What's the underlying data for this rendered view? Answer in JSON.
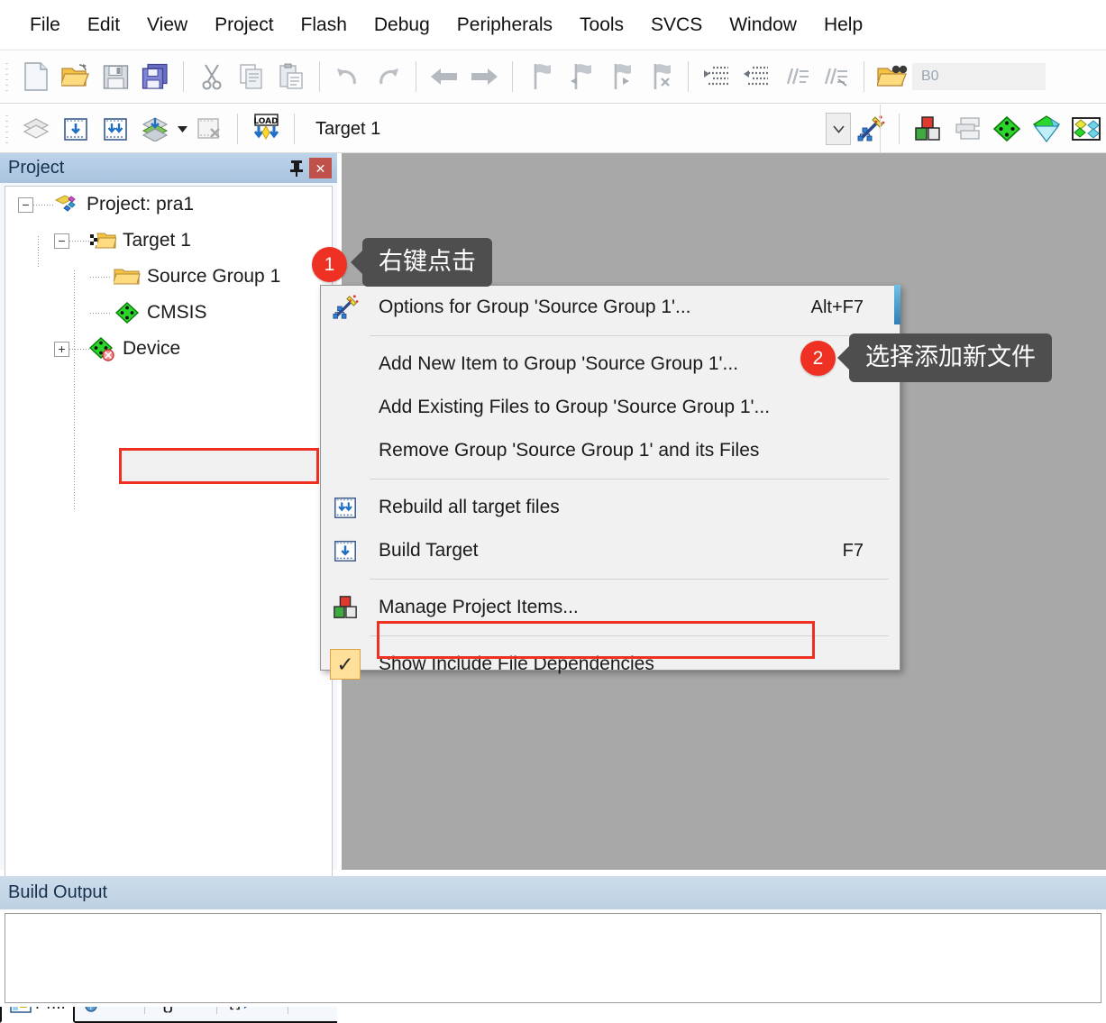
{
  "colors": {
    "accent_red": "#ef3124",
    "callout_bg": "#4e4e4e",
    "panel_header": "#bdd3ea",
    "editor_bg": "#a8a8a8",
    "menu_bg": "#f1f1f1",
    "close_btn": "#c0504a"
  },
  "menubar": {
    "items": [
      {
        "label": "File"
      },
      {
        "label": "Edit"
      },
      {
        "label": "View"
      },
      {
        "label": "Project"
      },
      {
        "label": "Flash"
      },
      {
        "label": "Debug"
      },
      {
        "label": "Peripherals"
      },
      {
        "label": "Tools"
      },
      {
        "label": "SVCS"
      },
      {
        "label": "Window"
      },
      {
        "label": "Help"
      }
    ]
  },
  "toolbar1": {
    "buttons": [
      {
        "name": "new-file-icon",
        "title": "New"
      },
      {
        "name": "open-file-icon",
        "title": "Open"
      },
      {
        "name": "save-icon",
        "title": "Save"
      },
      {
        "name": "save-all-icon",
        "title": "Save All"
      },
      {
        "name": "cut-icon",
        "title": "Cut"
      },
      {
        "name": "copy-icon",
        "title": "Copy"
      },
      {
        "name": "paste-icon",
        "title": "Paste"
      },
      {
        "name": "undo-icon",
        "title": "Undo"
      },
      {
        "name": "redo-icon",
        "title": "Redo"
      },
      {
        "name": "navigate-back-icon",
        "title": "Back"
      },
      {
        "name": "navigate-forward-icon",
        "title": "Forward"
      },
      {
        "name": "bookmark-toggle-icon",
        "title": "Insert/Remove Bookmark"
      },
      {
        "name": "bookmark-prev-icon",
        "title": "Previous Bookmark"
      },
      {
        "name": "bookmark-next-icon",
        "title": "Next Bookmark"
      },
      {
        "name": "bookmark-clear-icon",
        "title": "Clear All Bookmarks"
      },
      {
        "name": "indent-right-icon",
        "title": "Indent"
      },
      {
        "name": "indent-left-icon",
        "title": "Outdent"
      },
      {
        "name": "comment-icon",
        "title": "Comment"
      },
      {
        "name": "uncomment-icon",
        "title": "Uncomment"
      },
      {
        "name": "find-in-files-icon",
        "title": "Find in Files"
      }
    ],
    "find_value": "B0"
  },
  "toolbar2": {
    "buttons": [
      {
        "name": "translate-icon",
        "title": "Translate"
      },
      {
        "name": "build-icon",
        "title": "Build"
      },
      {
        "name": "rebuild-icon",
        "title": "Rebuild"
      },
      {
        "name": "batch-build-icon",
        "title": "Batch Build"
      },
      {
        "name": "stop-build-icon",
        "title": "Stop Build"
      },
      {
        "name": "download-icon",
        "title": "Download"
      }
    ],
    "target_name": "Target 1",
    "right_buttons": [
      {
        "name": "target-options-icon",
        "title": "Options for Target"
      },
      {
        "name": "manage-project-items-icon",
        "title": "Manage Project Items"
      },
      {
        "name": "multi-project-icon",
        "title": "Multi-Project"
      },
      {
        "name": "pack-installer-icon",
        "title": "Pack Installer"
      },
      {
        "name": "manage-run-time-icon",
        "title": "Manage Run-Time Environment"
      },
      {
        "name": "select-software-packs-icon",
        "title": "Select Software Packs"
      }
    ]
  },
  "project_panel": {
    "title": "Project",
    "pin_label": "⚐",
    "close_label": "✕",
    "tree": [
      {
        "label": "Project: pra1",
        "icon": "project-icon",
        "expander": "−",
        "depth": 0
      },
      {
        "label": "Target 1",
        "icon": "target-folder-icon",
        "expander": "−",
        "depth": 1
      },
      {
        "label": "Source Group 1",
        "icon": "folder-icon",
        "expander": "",
        "depth": 2,
        "selected": true
      },
      {
        "label": "CMSIS",
        "icon": "component-icon",
        "expander": "",
        "depth": 2
      },
      {
        "label": "Device",
        "icon": "device-icon",
        "expander": "+",
        "depth": 2
      }
    ],
    "tabs": [
      {
        "label": "Pr...",
        "icon": "project-view-icon",
        "active": true
      },
      {
        "label": "B...",
        "icon": "books-view-icon",
        "active": false
      },
      {
        "label": "F...",
        "icon": "functions-view-icon",
        "active": false
      },
      {
        "label": "T...",
        "icon": "templates-view-icon",
        "active": false
      }
    ],
    "scroll_left_arrow": "◀",
    "scroll_right_arrow": "▶"
  },
  "context_menu": {
    "items": [
      {
        "label": "Options for Group 'Source Group 1'...",
        "accel": "Alt+F7",
        "icon": "magic-wand-icon",
        "separator_after": true
      },
      {
        "label": "Add New  Item to Group 'Source Group 1'...",
        "accel": "",
        "icon": "",
        "highlighted": true
      },
      {
        "label": "Add Existing Files to Group 'Source Group 1'...",
        "accel": "",
        "icon": ""
      },
      {
        "label": "Remove Group 'Source Group 1' and its Files",
        "accel": "",
        "icon": "",
        "separator_after": true
      },
      {
        "label": "Rebuild all target files",
        "accel": "",
        "icon": "rebuild-icon"
      },
      {
        "label": "Build Target",
        "accel": "F7",
        "icon": "build-icon",
        "separator_after": true
      },
      {
        "label": "Manage Project Items...",
        "accel": "",
        "icon": "manage-items-icon",
        "separator_after": true
      },
      {
        "label": "Show Include File Dependencies",
        "accel": "",
        "icon": "checkmark-icon",
        "checked": true
      }
    ]
  },
  "annotations": [
    {
      "number": "1",
      "text": "右键点击"
    },
    {
      "number": "2",
      "text": "选择添加新文件"
    }
  ],
  "build_output": {
    "title": "Build Output",
    "content": ""
  }
}
